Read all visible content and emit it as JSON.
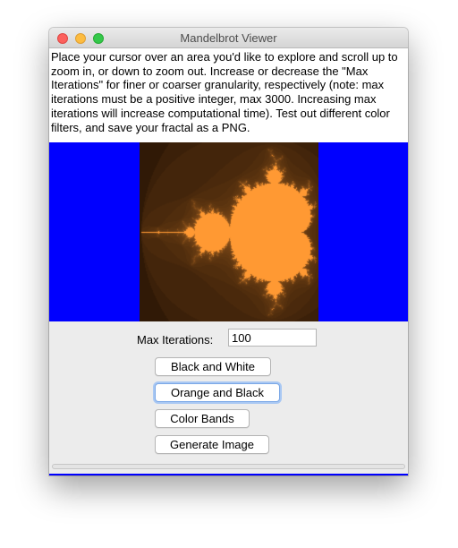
{
  "window": {
    "title": "Mandelbrot Viewer"
  },
  "instructions": "Place your cursor over an area you'd like to explore and scroll up to zoom in, or down to zoom out. Increase or decrease the \"Max Iterations\" for finer or coarser granularity, respectively (note: max iterations must be a positive integer, max 3000. Increasing max iterations will increase computational time). Test out different color filters, and save your fractal as a PNG.",
  "colors": {
    "background_fill": "#0000ff",
    "fractal_fill": "#ff9933",
    "fractal_outside": "#120700"
  },
  "controls": {
    "max_iterations_label": "Max Iterations:",
    "max_iterations_value": "100",
    "buttons": {
      "black_white": "Black and White",
      "orange_black": "Orange and Black",
      "color_bands": "Color Bands",
      "generate_image": "Generate Image"
    }
  }
}
